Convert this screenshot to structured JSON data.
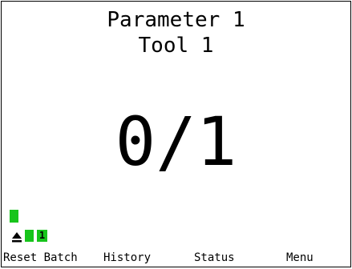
{
  "header": {
    "parameter": "Parameter 1",
    "tool": "Tool 1"
  },
  "counter": {
    "display": "0/1",
    "done": 0,
    "total": 1
  },
  "status": {
    "batch_badge": "1",
    "indicator_color": "#17c41b",
    "icons": [
      "eject-icon"
    ]
  },
  "softkeys": {
    "reset_batch": "Reset Batch",
    "history": "History",
    "status": "Status",
    "menu": "Menu"
  }
}
